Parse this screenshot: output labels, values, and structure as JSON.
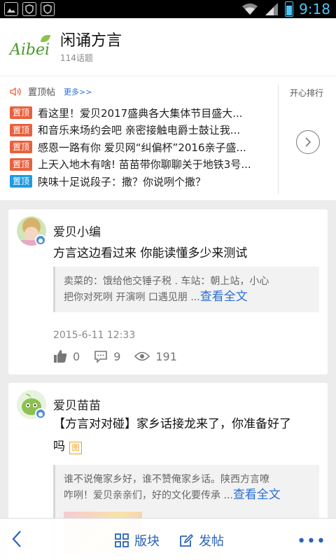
{
  "status_bar": {
    "time": "9:18"
  },
  "header": {
    "logo_text": "Aibei",
    "title": "闲诵方言",
    "topic_count": "114话题"
  },
  "pinned": {
    "label": "置顶帖",
    "more": "更多>>",
    "ranking_label": "开心排行",
    "items": [
      {
        "badge": "置顶",
        "badge_color": "#e8613d",
        "text": "看这里！爱贝2017盛典各大集体节目盛大..."
      },
      {
        "badge": "置顶",
        "badge_color": "#e8613d",
        "text": "和音乐来场约会吧 亲密接触电爵士鼓让我..."
      },
      {
        "badge": "置顶",
        "badge_color": "#e8613d",
        "text": "感恩一路有你 爱贝网“纠偏杯”2016亲子盛..."
      },
      {
        "badge": "置顶",
        "badge_color": "#e8613d",
        "text": "上天入地木有啥! 苗苗带你聊聊关于地铁3号..."
      },
      {
        "badge": "置顶",
        "badge_color": "#1e9be0",
        "text": "陕味十足说段子：撒？你说咧个撒？"
      }
    ]
  },
  "posts": [
    {
      "author": "爱贝小编",
      "title": "方言这边看过来 你能读懂多少来测试",
      "quote_lines": [
        "卖菜的：饿给他交锤子税 . 车站：朝上站，小心",
        "把你对死咧 开演咧 口遇见朋 ..."
      ],
      "read_more": "查看全文",
      "date": "2015-6-11 12:33",
      "likes": "0",
      "comments": "9",
      "views": "191"
    },
    {
      "author": "爱贝苗苗",
      "title_line1": "【方言对对碰】家乡话接龙来了，你准备好了",
      "title_line2": "吗",
      "tag_icon": "图",
      "quote_lines": [
        "谁不说俺家乡好，谁不赞俺家乡话。陕西方言嘹",
        "咋咧！爱贝亲亲们，好的文化要传承 ..."
      ],
      "read_more": "查看全文"
    }
  ],
  "bottom_bar": {
    "board": "版块",
    "post": "发帖",
    "more": "•••"
  },
  "colors": {
    "accent_blue": "#2a63b8",
    "badge_orange": "#e8613d",
    "badge_blue": "#1e9be0",
    "status_blue": "#4fc3f7"
  }
}
